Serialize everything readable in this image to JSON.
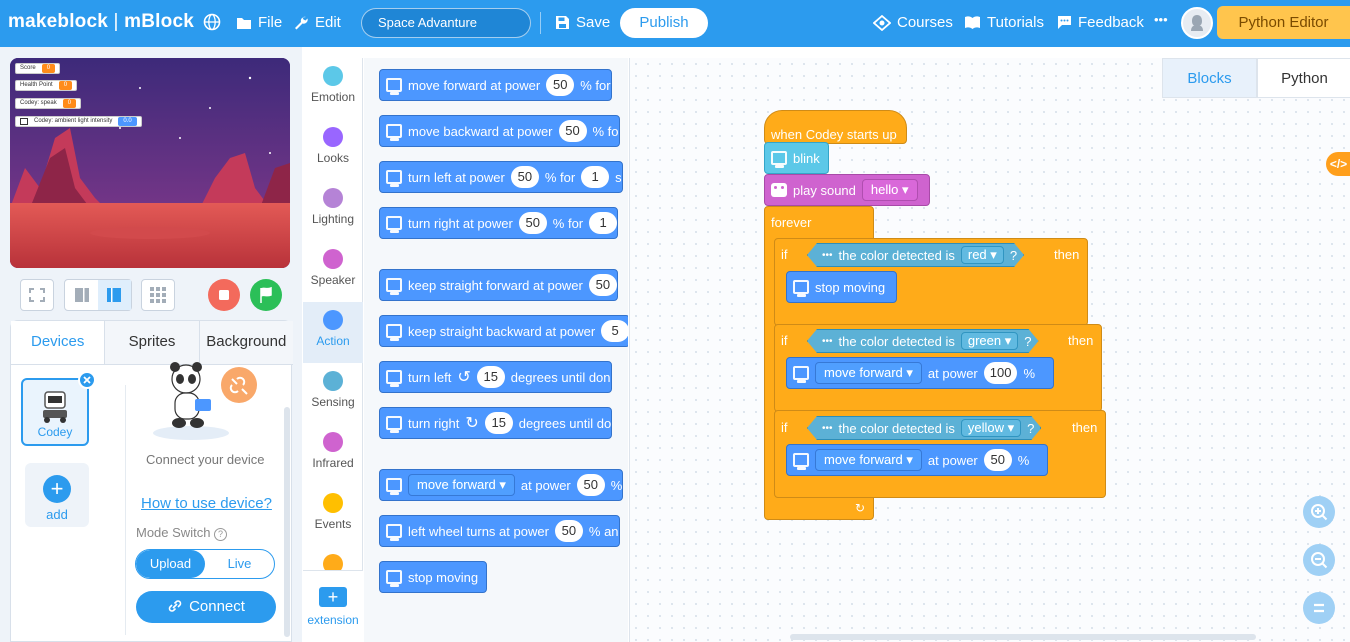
{
  "topbar": {
    "logo_brand": "makeblock",
    "logo_sep": "|",
    "logo_app": "mBlock",
    "globe_icon": "globe-icon",
    "file_label": "File",
    "edit_label": "Edit",
    "project_name": "Space Advanture",
    "save_label": "Save",
    "publish_label": "Publish",
    "courses_label": "Courses",
    "tutorials_label": "Tutorials",
    "feedback_label": "Feedback",
    "more_label": "•••",
    "python_editor_label": "Python Editor",
    "accent": "#2c9bee"
  },
  "stage": {
    "vars": [
      {
        "name": "Score",
        "value": "0"
      },
      {
        "name": "Health Point",
        "value": "0"
      },
      {
        "name": "Codey: speak",
        "value": "0"
      },
      {
        "name": "Codey: ambient light intensity",
        "value": "0.0"
      }
    ]
  },
  "devices": {
    "tabs": [
      "Devices",
      "Sprites",
      "Background"
    ],
    "device_name": "Codey",
    "add_label": "add",
    "connect_hint": "Connect your device",
    "howto_label": "How to use device?",
    "mode_switch_label": "Mode Switch",
    "help_glyph": "?",
    "upload_label": "Upload",
    "live_label": "Live",
    "connect_label": "Connect"
  },
  "categories": [
    {
      "label": "Emotion",
      "color": "#5cc8e8"
    },
    {
      "label": "Looks",
      "color": "#9966ff"
    },
    {
      "label": "Lighting",
      "color": "#b583d6"
    },
    {
      "label": "Speaker",
      "color": "#cf63cf"
    },
    {
      "label": "Action",
      "color": "#4c97ff"
    },
    {
      "label": "Sensing",
      "color": "#5cb1d6"
    },
    {
      "label": "Infrared",
      "color": "#cf63cf"
    },
    {
      "label": "Events",
      "color": "#ffbf00"
    },
    {
      "label": "",
      "color": "#ffab19"
    }
  ],
  "extension_label": "extension",
  "palette": [
    {
      "text1": "move forward at power",
      "v1": "50",
      "text2": "% for"
    },
    {
      "text1": "move backward at power",
      "v1": "50",
      "text2": "% fo"
    },
    {
      "text1": "turn left at power",
      "v1": "50",
      "text2": "% for",
      "v2": "1",
      "text3": "s"
    },
    {
      "text1": "turn right at power",
      "v1": "50",
      "text2": "% for",
      "v2": "1"
    },
    {
      "text1": "keep straight  forward at power",
      "v1": "50"
    },
    {
      "text1": "keep straight backward at power",
      "v1": "5"
    },
    {
      "text1": "turn left",
      "glyph": "↺",
      "v1": "15",
      "text2": "degrees until don"
    },
    {
      "text1": "turn right",
      "glyph": "↻",
      "v1": "15",
      "text2": "degrees until do"
    },
    {
      "dd": "move forward ▾",
      "text1": "at power",
      "v1": "50",
      "text2": "%"
    },
    {
      "text1": "left wheel turns at power",
      "v1": "50",
      "text2": "% an"
    },
    {
      "text1": "stop moving"
    }
  ],
  "workspace": {
    "tabs": [
      "Blocks",
      "Python"
    ],
    "code_tab_glyph": "</>",
    "hat": "when Codey starts up",
    "blink": "blink",
    "play_sound": "play sound",
    "sound_option": "hello ▾",
    "forever": "forever",
    "if_label": "if",
    "then_label": "then",
    "q": "?",
    "color_detected": "the color detected is",
    "cond1": "red ▾",
    "cond2": "green ▾",
    "cond3": "yellow ▾",
    "stop_moving": "stop moving",
    "move_dd": "move forward ▾",
    "at_power": "at power",
    "power1": "100",
    "power2": "50",
    "pct": "%",
    "loop_arrow": "↻"
  }
}
